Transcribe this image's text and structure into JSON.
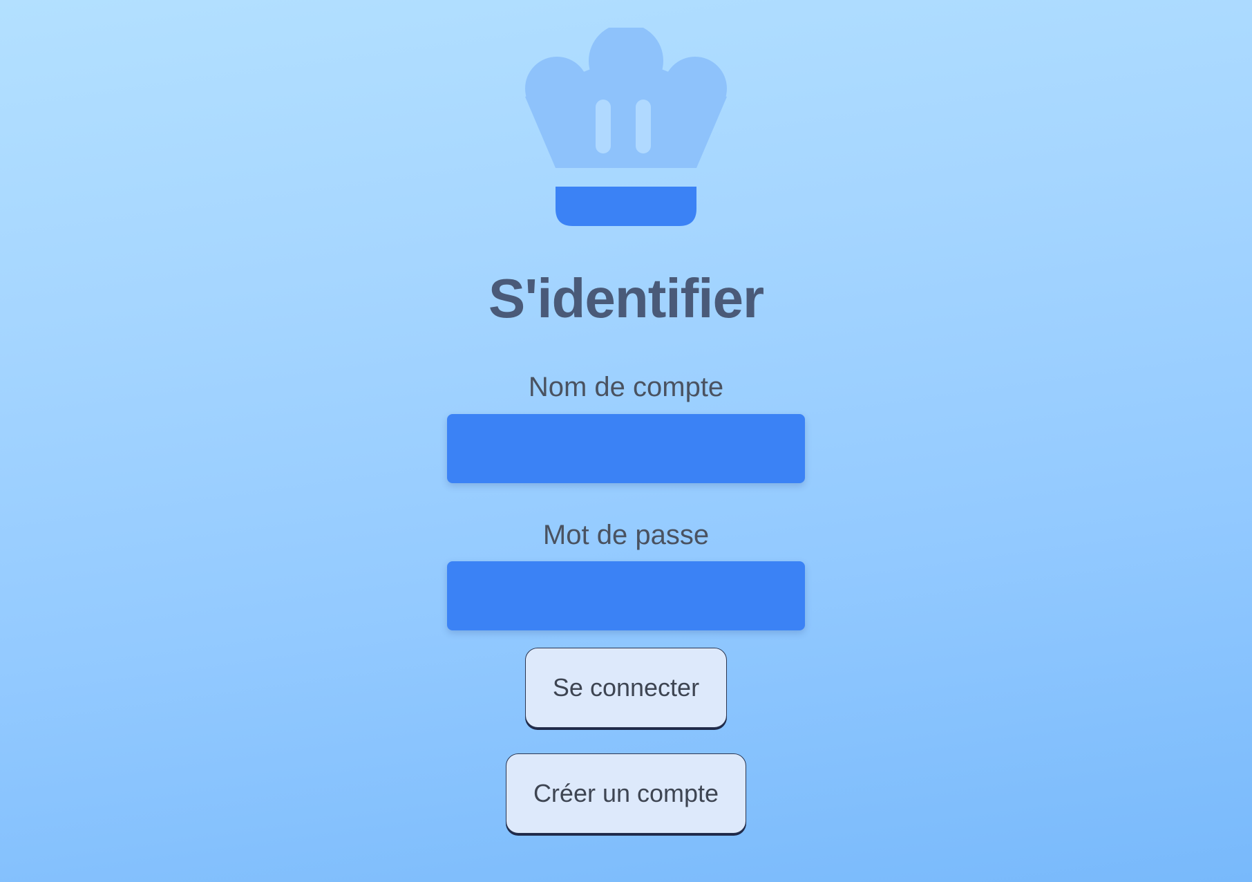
{
  "app": {
    "logo_icon": "chef-hat-icon",
    "title": "S'identifier"
  },
  "form": {
    "username": {
      "label": "Nom de compte",
      "value": "",
      "placeholder": ""
    },
    "password": {
      "label": "Mot de passe",
      "value": "",
      "placeholder": ""
    }
  },
  "actions": {
    "login_label": "Se connecter",
    "create_account_label": "Créer un compte"
  },
  "colors": {
    "background_top": "#b3e0ff",
    "background_bottom": "#78b9fb",
    "accent": "#3b82f5",
    "hat_light": "#8ec2fb",
    "title_text": "#4a5a78",
    "button_bg": "#dde9fb"
  }
}
